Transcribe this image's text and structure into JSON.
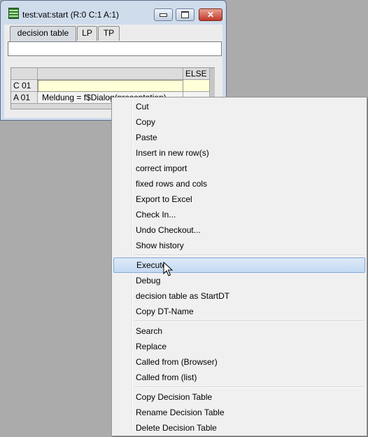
{
  "window": {
    "title": "test:vat:start  (R:0  C:1  A:1)",
    "tabs": [
      "decision table",
      "LP",
      "TP"
    ],
    "grid": {
      "else_header": "ELSE",
      "rows": [
        {
          "label": "C 01",
          "value": ""
        },
        {
          "label": "A 01",
          "value": "Meldung = f$Dialog(presentation)..."
        }
      ]
    }
  },
  "menu": {
    "group1": [
      "Cut",
      "Copy",
      "Paste",
      "Insert in new row(s)",
      "correct import",
      "fixed rows and cols",
      "Export to Excel",
      "Check In...",
      "Undo Checkout...",
      "Show history"
    ],
    "group2": [
      "Execute",
      "Debug",
      "decision table as StartDT",
      "Copy DT-Name"
    ],
    "group3": [
      "Search",
      "Replace",
      "Called from (Browser)",
      "Called from (list)"
    ],
    "group4": [
      "Copy Decision Table",
      "Rename Decision Table",
      "Delete Decision Table"
    ],
    "highlighted": "Execute"
  }
}
